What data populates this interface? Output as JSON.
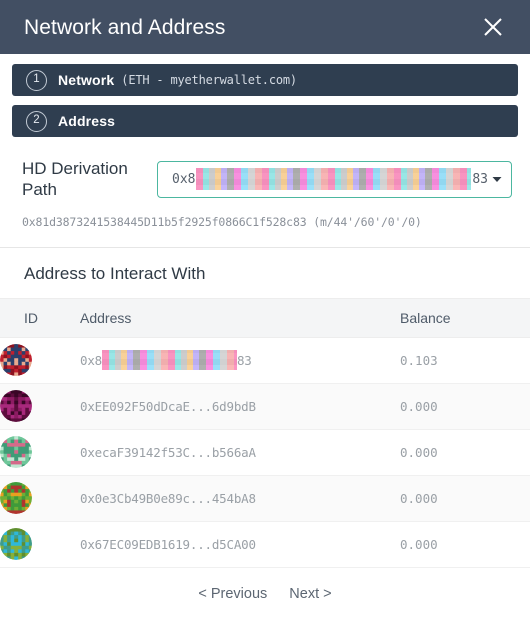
{
  "header": {
    "title": "Network and Address",
    "close_icon": "close-icon"
  },
  "steps": [
    {
      "number": "1",
      "label": "Network",
      "sub": "(ETH - myetherwallet.com)"
    },
    {
      "number": "2",
      "label": "Address",
      "sub": ""
    }
  ],
  "derivation": {
    "label": "HD Derivation Path",
    "field_prefix": "0x8",
    "field_suffix": "83",
    "field_redacted": true,
    "caret_icon": "chevron-down-icon",
    "full_text": "0x81d3873241538445D11b5f2925f0866C1f528c83 (m/44'/60'/0'/0)"
  },
  "table": {
    "section_title": "Address to Interact With",
    "columns": [
      "ID",
      "Address",
      "Balance"
    ],
    "rows": [
      {
        "avatar": "identicon-red",
        "address_prefix": "0x8",
        "address_suffix": "83",
        "redacted": true,
        "address": "",
        "balance": "0.103"
      },
      {
        "avatar": "identicon-purple",
        "redacted": false,
        "address": "0xEE092F50dDcaE...6d9bdB",
        "balance": "0.000"
      },
      {
        "avatar": "identicon-green",
        "redacted": false,
        "address": "0xecaF39142f53C...b566aA",
        "balance": "0.000"
      },
      {
        "avatar": "identicon-orange",
        "redacted": false,
        "address": "0x0e3Cb49B0e89c...454bA8",
        "balance": "0.000"
      },
      {
        "avatar": "identicon-cyan",
        "redacted": false,
        "address": "0x67EC09EDB1619...d5CA00",
        "balance": "0.000"
      }
    ]
  },
  "pagination": {
    "previous": "< Previous",
    "next": "Next >"
  },
  "colors": {
    "header_bg": "#424f63",
    "step_bg": "#2f3e50",
    "accent_border": "#4cb7a0",
    "table_header_bg": "#f4f5f6",
    "muted_text": "#9aa0a6"
  }
}
